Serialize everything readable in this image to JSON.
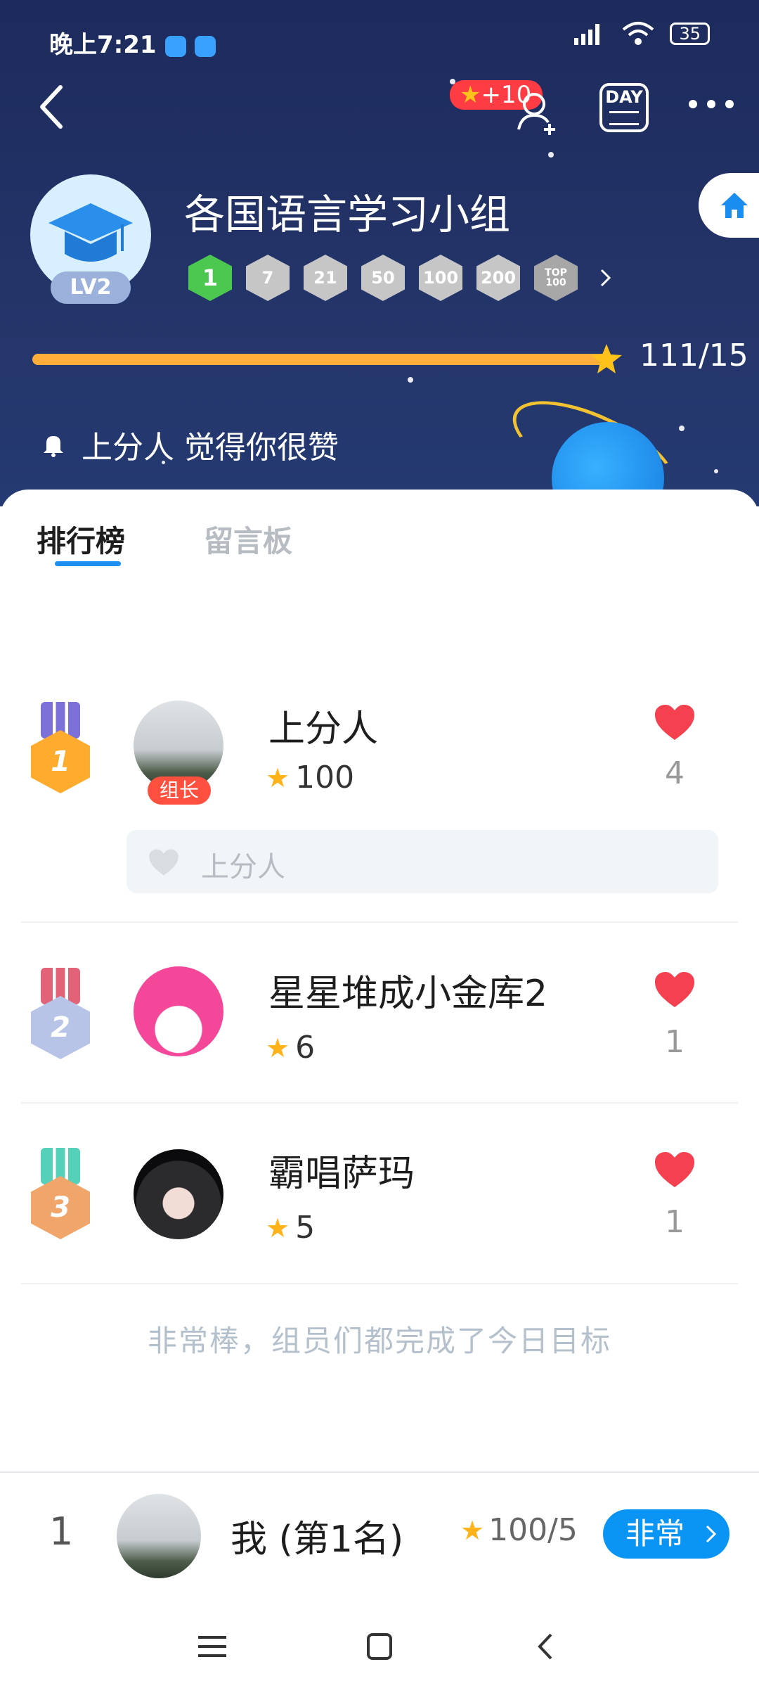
{
  "status_bar": {
    "time": "晚上7:21",
    "battery": "35"
  },
  "header": {
    "bonus_badge": "+10",
    "day_label": "DAY",
    "group_name": "各国语言学习小组",
    "level_label": "LV2",
    "milestones": [
      "1",
      "7",
      "21",
      "50",
      "100",
      "200"
    ],
    "milestone_top_label": "TOP 100",
    "progress_text": "111/15",
    "progress_fraction": 1.0,
    "notice_text": "上分人 觉得你很赞"
  },
  "tabs": {
    "ranking": "排行榜",
    "message_board": "留言板"
  },
  "ranking": [
    {
      "rank": "1",
      "name": "上分人",
      "score": "100",
      "likes": "4",
      "badge": "组长",
      "liked_by": "上分人"
    },
    {
      "rank": "2",
      "name": "星星堆成小金库2",
      "score": "6",
      "likes": "1"
    },
    {
      "rank": "3",
      "name": "霸唱萨玛",
      "score": "5",
      "likes": "1"
    }
  ],
  "footer_message": "非常棒，组员们都完成了今日目标",
  "me": {
    "rank": "1",
    "name": "我 (第1名)",
    "score": "100/5",
    "button_label": "非常"
  },
  "colors": {
    "accent": "#0a95f4",
    "progress": "#ffae3a",
    "header_bg": "#1d2a5c",
    "heart": "#f4404f"
  }
}
